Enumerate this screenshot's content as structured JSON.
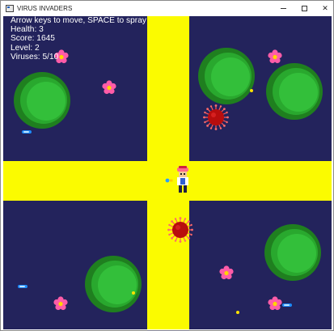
{
  "window": {
    "title": "VIRUS INVADERS",
    "controls": {
      "minimize": "−",
      "maximize": "□",
      "close": "✕"
    }
  },
  "hud": {
    "instructions": "Arrow keys to move, SPACE to spray",
    "health": "Health: 3",
    "score": "Score: 1645",
    "level": "Level: 2",
    "viruses": "Viruses: 5/10"
  },
  "colors": {
    "background": "#23235c",
    "road": "#fbfb00",
    "bush_dark": "#1f7f1f",
    "bush_mid": "#29a82e",
    "bush_light": "#33bf3a",
    "flower": "#ff5ca8",
    "virus": "#cc1010",
    "spray": "#1c8cff"
  },
  "icons": {
    "app": "window-icon",
    "player": "player-sprite",
    "virus": "virus-icon",
    "flower": "flower-icon",
    "bush": "bush-icon"
  }
}
